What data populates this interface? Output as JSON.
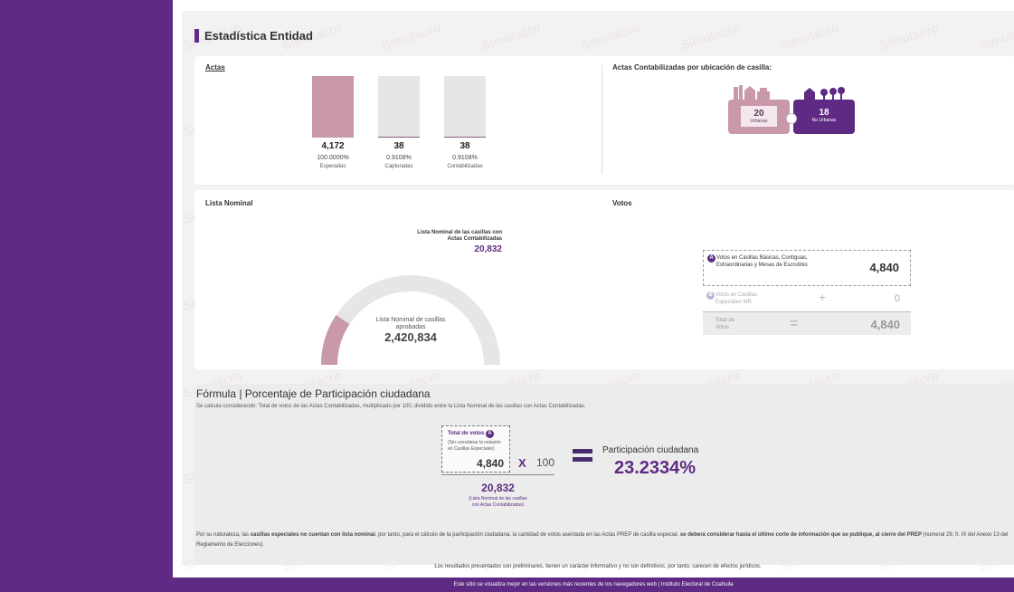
{
  "header": {
    "title": "Estadística Entidad"
  },
  "watermark": "Simulacro",
  "actas": {
    "label": "Actas",
    "columns": [
      {
        "number": "4,172",
        "percent": "100.0000%",
        "label": "Esperadas",
        "fraction": 1.0
      },
      {
        "number": "38",
        "percent": "0.9108%",
        "label": "Capturadas",
        "fraction": 0.009108
      },
      {
        "number": "38",
        "percent": "0.9108%",
        "label": "Contabilizadas",
        "fraction": 0.009108
      }
    ]
  },
  "ubicacion": {
    "label": "Actas Contabilizadas por ubicación de casilla:",
    "urbanas": {
      "number": "20",
      "label": "Urbanas"
    },
    "no_urbanas": {
      "number": "18",
      "label": "No Urbanas"
    }
  },
  "lista_nominal": {
    "label": "Lista Nominal",
    "contabilizadas_title": "Lista Nominal de las casillas con Actas Contabilizadas",
    "contabilizadas_value": "20,832",
    "gauge_title": "Lista Nominal de casillas aprobadas",
    "gauge_value": "2,420,834"
  },
  "votos": {
    "label": "Votos",
    "basicas": {
      "badge": "A",
      "label": "Votos en Casillas Básicas, Contiguas, Extraordinarias y Mesas de Escrutinio",
      "value": "4,840"
    },
    "especiales": {
      "badge": "B",
      "label": "Votos en Casillas Especiales MR",
      "operator": "+",
      "value": "0"
    },
    "total": {
      "label": "Total de Votos",
      "operator": "=",
      "value": "4,840"
    }
  },
  "formula": {
    "title": "Fórmula | Porcentaje de Participación ciudadana",
    "description": "Se calcula considerando: Total de votos de las Actas Contabilizadas, multiplicado por 100, dividido entre la Lista Nominal de las casillas con Actas Contabilizadas.",
    "total_votos_label": "Total de votos",
    "total_votos_badge": "A",
    "total_votos_note": "(Sin considerar la votación en Casillas Especiales)",
    "total_votos_value": "4,840",
    "multiply": "X",
    "hundred": "100",
    "divisor_value": "20,832",
    "divisor_note": "(Lista Nominal de las casillas con Actas Contabilizadas)",
    "result_label": "Participación ciudadana",
    "result_value": "23.2334%",
    "note_part1": "Por su naturaleza, las ",
    "note_bold1": "casillas especiales no cuentan con lista nominal",
    "note_part2": ", por tanto, para el cálculo de la participación ciudadana, la cantidad de votos asentada en las Actas PREP de casilla especial, ",
    "note_bold2": "se deberá considerar hasta el último corte de información que se publique, al cierre del PREP",
    "note_part3": " (numeral 29, fr. IX del Anexo 13 del Reglamento de Elecciones)."
  },
  "disclaimer": "Los resultados presentados son preliminares, tienen un carácter informativo y no son definitivos, por tanto, carecen de efectos jurídicos.",
  "footer": "Este sitio se visualiza mejor en las versiones más recientes de los navegadores web  |  Instituto Electoral de Coahuila",
  "colors": {
    "purple": "#5e2a84",
    "rose": "#c998ab",
    "gray": "#e6e6e6"
  }
}
